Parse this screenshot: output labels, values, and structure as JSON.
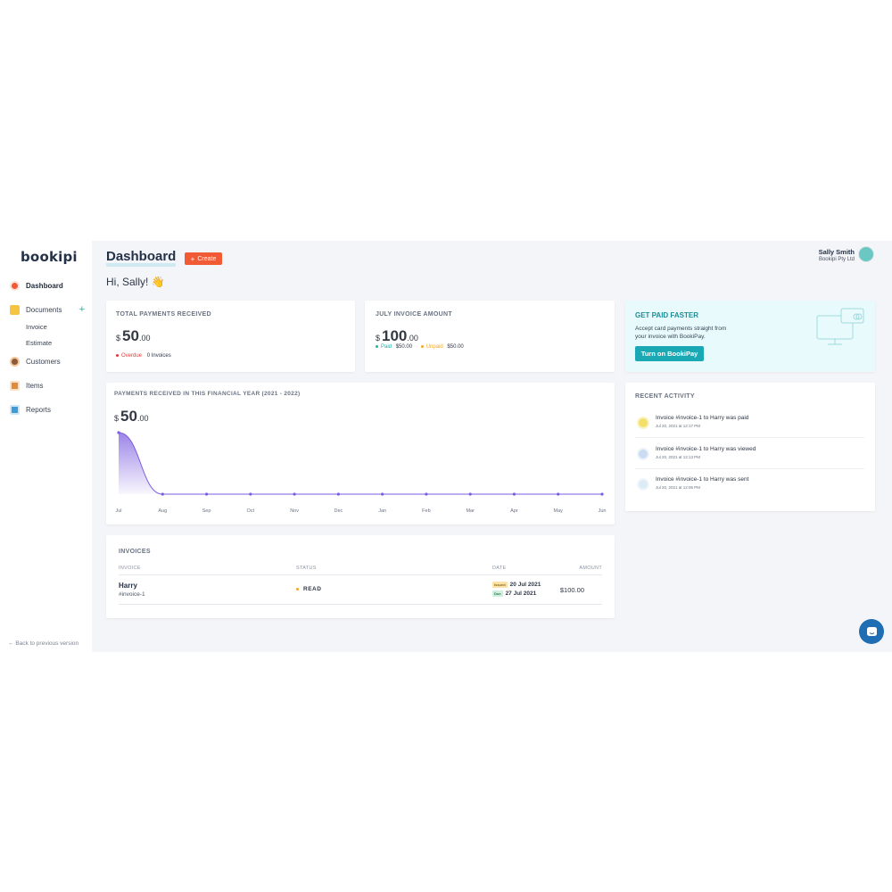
{
  "sidebar": {
    "logo": "bookipi",
    "items": [
      {
        "label": "Dashboard",
        "icon": "dashboard-icon",
        "color": "#f05a35"
      },
      {
        "label": "Documents",
        "icon": "documents-icon",
        "color": "#f5c542"
      },
      {
        "label": "Customers",
        "icon": "customers-icon",
        "color": "#8b5a3c"
      },
      {
        "label": "Items",
        "icon": "items-icon",
        "color": "#e08a3c"
      },
      {
        "label": "Reports",
        "icon": "reports-icon",
        "color": "#3f9bd6"
      }
    ],
    "sub_items": [
      "Invoice",
      "Estimate"
    ],
    "plus": "+",
    "back_label": "Back to previous version"
  },
  "header": {
    "title": "Dashboard",
    "create_label": "Create",
    "user_name": "Sally Smith",
    "company": "Bookipi Pty Ltd",
    "greeting": "Hi, Sally! 👋"
  },
  "total_payments": {
    "title": "TOTAL PAYMENTS RECEIVED",
    "currency": "$",
    "amount": "50",
    "decimals": ".00",
    "overdue_label": "Overdue",
    "overdue_value": "0 Invoices"
  },
  "july_invoice": {
    "title": "JULY INVOICE AMOUNT",
    "currency": "$",
    "amount": "100",
    "decimals": ".00",
    "paid_label": "Paid",
    "paid_value": "$50.00",
    "unpaid_label": "Unpaid",
    "unpaid_value": "$50.00"
  },
  "promo": {
    "title": "GET PAID FASTER",
    "text1": "Accept card payments straight from",
    "text2": "your invoice with BookiPay.",
    "button": "Turn on BookiPay"
  },
  "chart_card": {
    "title": "PAYMENTS RECEIVED IN THIS FINANCIAL YEAR (2021 - 2022)",
    "currency": "$",
    "amount": "50",
    "decimals": ".00"
  },
  "chart_data": {
    "type": "area",
    "categories": [
      "Jul",
      "Aug",
      "Sep",
      "Oct",
      "Nov",
      "Dec",
      "Jan",
      "Feb",
      "Mar",
      "Apr",
      "May",
      "Jun"
    ],
    "values": [
      50,
      0,
      0,
      0,
      0,
      0,
      0,
      0,
      0,
      0,
      0,
      0
    ],
    "ylim": [
      0,
      50
    ],
    "grid": false,
    "color": "#7b5ce0"
  },
  "activity": {
    "title": "RECENT ACTIVITY",
    "items": [
      {
        "text": "Invoice #invoice-1 to Harry was paid",
        "time": "Jul 20, 2021 at 12:17 PM",
        "color": "#f2e06b"
      },
      {
        "text": "Invoice #invoice-1 to Harry was viewed",
        "time": "Jul 20, 2021 at 12:13 PM",
        "color": "#c9dcf2"
      },
      {
        "text": "Invoice #invoice-1 to Harry was sent",
        "time": "Jul 20, 2021 at 12:06 PM",
        "color": "#dcecf5"
      }
    ]
  },
  "invoices": {
    "title": "INVOICES",
    "columns": {
      "invoice": "INVOICE",
      "status": "STATUS",
      "date": "DATE",
      "amount": "AMOUNT"
    },
    "rows": [
      {
        "customer": "Harry",
        "number": "#invoice-1",
        "status": "READ",
        "issued_tag": "Issued",
        "issued_date": "20 Jul 2021",
        "due_tag": "Due",
        "due_date": "27 Jul 2021",
        "amount": "$100.00"
      }
    ]
  },
  "colors": {
    "accent": "#f05a35",
    "teal": "#1aa8b5",
    "overdue": "#e53935",
    "paid": "#1ab3a6",
    "unpaid": "#f5a623",
    "status_read": "#f5a623"
  }
}
